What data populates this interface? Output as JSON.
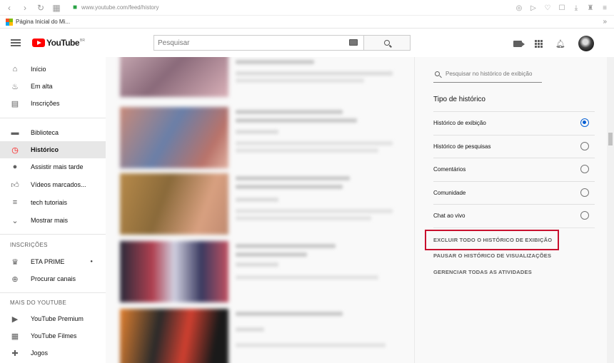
{
  "browser": {
    "url": "www.youtube.com/feed/history",
    "bookmark_label": "Página Inicial do Mi...",
    "more": "»"
  },
  "header": {
    "logo_text": "YouTube",
    "logo_suffix": "BR",
    "search_placeholder": "Pesquisar"
  },
  "sidebar": {
    "main_items": [
      {
        "label": "Início",
        "icon": "home-icon"
      },
      {
        "label": "Em alta",
        "icon": "fire-icon"
      },
      {
        "label": "Inscrições",
        "icon": "subscriptions-icon"
      }
    ],
    "library_items": [
      {
        "label": "Biblioteca",
        "icon": "folder-icon"
      },
      {
        "label": "Histórico",
        "icon": "history-icon",
        "active": true
      },
      {
        "label": "Assistir mais tarde",
        "icon": "clock-icon"
      },
      {
        "label": "Vídeos marcados...",
        "icon": "thumbs-up-icon"
      },
      {
        "label": "tech tutoriais",
        "icon": "playlist-icon"
      },
      {
        "label": "Mostrar mais",
        "icon": "chevron-down-icon"
      }
    ],
    "subscriptions_heading": "INSCRIÇÕES",
    "subscriptions": [
      {
        "label": "ETA PRIME",
        "icon": "channel-avatar-icon"
      },
      {
        "label": "Procurar canais",
        "icon": "add-circle-icon"
      }
    ],
    "more_heading": "MAIS DO YOUTUBE",
    "more_items": [
      {
        "label": "YouTube Premium",
        "icon": "youtube-premium-icon"
      },
      {
        "label": "YouTube Filmes",
        "icon": "film-icon"
      },
      {
        "label": "Jogos",
        "icon": "gamepad-icon"
      }
    ]
  },
  "panel": {
    "search_placeholder": "Pesquisar no histórico de exibição",
    "type_heading": "Tipo de histórico",
    "options": [
      {
        "label": "Histórico de exibição",
        "checked": true
      },
      {
        "label": "Histórico de pesquisas",
        "checked": false
      },
      {
        "label": "Comentários",
        "checked": false
      },
      {
        "label": "Comunidade",
        "checked": false
      },
      {
        "label": "Chat ao vivo",
        "checked": false
      }
    ],
    "actions": {
      "clear_all": "EXCLUIR TODO O HISTÓRICO DE EXIBIÇÃO",
      "pause": "PAUSAR O HISTÓRICO DE VISUALIZAÇÕES",
      "manage": "GERENCIAR TODAS AS ATIVIDADES"
    },
    "highlight_color": "#c8102e"
  },
  "colors": {
    "accent_red": "#ff0000",
    "radio_blue": "#065fd4"
  }
}
